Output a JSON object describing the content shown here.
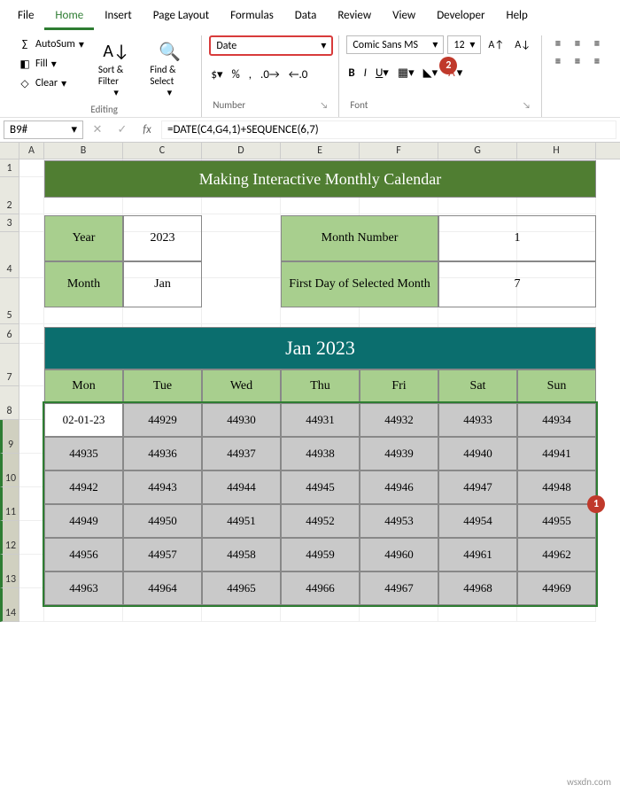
{
  "menu": {
    "file": "File",
    "home": "Home",
    "insert": "Insert",
    "page_layout": "Page Layout",
    "formulas": "Formulas",
    "data": "Data",
    "review": "Review",
    "view": "View",
    "developer": "Developer",
    "help": "Help"
  },
  "ribbon": {
    "autosum": "AutoSum",
    "fill": "Fill",
    "clear": "Clear",
    "sort": "Sort & Filter",
    "find": "Find & Select",
    "nfmt_value": "Date",
    "nfmt_dd": "▾",
    "font_name": "Comic Sans MS",
    "font_size": "12",
    "groups": {
      "editing": "Editing",
      "number": "Number",
      "font": "Font"
    }
  },
  "namebox": "B9#",
  "formula": "=DATE(C4,G4,1)+SEQUENCE(6,7)",
  "cols": [
    "",
    "A",
    "B",
    "C",
    "D",
    "E",
    "F",
    "G",
    "H"
  ],
  "rows": [
    "1",
    "2",
    "3",
    "4",
    "5",
    "6",
    "7",
    "8",
    "9",
    "10",
    "11",
    "12",
    "13",
    "14"
  ],
  "sheet": {
    "title": "Making Interactive Monthly Calendar",
    "year_label": "Year",
    "year_val": "2023",
    "month_label": "Month",
    "month_val": "Jan",
    "monthnum_label": "Month Number",
    "monthnum_val": "1",
    "firstday_label": "First Day of Selected Month",
    "firstday_val": "7",
    "cal_title": "Jan 2023",
    "days": [
      "Mon",
      "Tue",
      "Wed",
      "Thu",
      "Fri",
      "Sat",
      "Sun"
    ],
    "cells": [
      [
        "02-01-23",
        "44929",
        "44930",
        "44931",
        "44932",
        "44933",
        "44934"
      ],
      [
        "44935",
        "44936",
        "44937",
        "44938",
        "44939",
        "44940",
        "44941"
      ],
      [
        "44942",
        "44943",
        "44944",
        "44945",
        "44946",
        "44947",
        "44948"
      ],
      [
        "44949",
        "44950",
        "44951",
        "44952",
        "44953",
        "44954",
        "44955"
      ],
      [
        "44956",
        "44957",
        "44958",
        "44959",
        "44960",
        "44961",
        "44962"
      ],
      [
        "44963",
        "44964",
        "44965",
        "44966",
        "44967",
        "44968",
        "44969"
      ]
    ]
  },
  "badges": {
    "b1": "1",
    "b2": "2"
  },
  "watermark": "wsxdn.com"
}
